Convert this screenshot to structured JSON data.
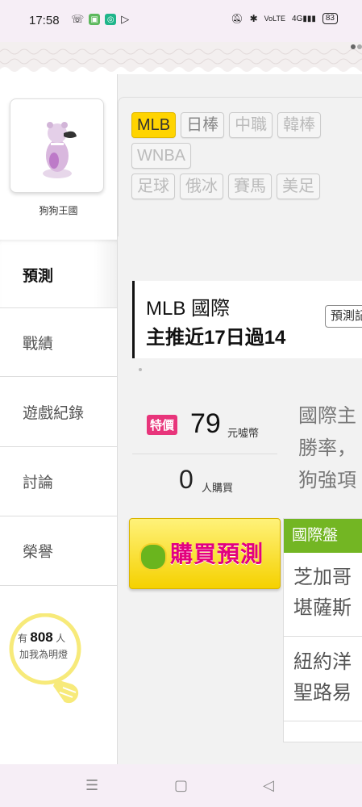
{
  "status_bar": {
    "time": "17:58",
    "battery": "83",
    "network": "4G"
  },
  "profile": {
    "name": "狗狗王國"
  },
  "leagues": [
    {
      "label": "MLB",
      "state": "active"
    },
    {
      "label": "日棒",
      "state": "normal"
    },
    {
      "label": "中職",
      "state": "dim"
    },
    {
      "label": "韓棒",
      "state": "dim"
    },
    {
      "label": "WNBA",
      "state": "dim"
    },
    {
      "label": "足球",
      "state": "dim"
    },
    {
      "label": "俄冰",
      "state": "dim"
    },
    {
      "label": "賽馬",
      "state": "dim"
    },
    {
      "label": "美足",
      "state": "dim"
    }
  ],
  "sidebar": {
    "tabs": [
      {
        "label": "預測"
      },
      {
        "label": "戰績"
      },
      {
        "label": "遊戲紀錄"
      },
      {
        "label": "討論"
      },
      {
        "label": "榮譽"
      }
    ],
    "fans": {
      "prefix": "有",
      "count": "808",
      "suffix": "人",
      "line2": "加我為明燈"
    }
  },
  "prediction": {
    "title": "MLB 國際",
    "subtitle": "主推近17日過14",
    "button_label": "預測記"
  },
  "offer": {
    "badge": "特價",
    "price": "79",
    "currency": "元噓幣",
    "buyers": "0",
    "buyers_unit": "人購買",
    "desc_lines": [
      "國際主",
      "勝率，",
      "狗強項"
    ]
  },
  "buy_button": {
    "label": "購買預測"
  },
  "intl_panel": {
    "header": "國際盤",
    "games": [
      {
        "line1": "芝加哥",
        "line2": "堪薩斯"
      },
      {
        "line1": "紐約洋",
        "line2": "聖路易"
      }
    ]
  },
  "colors": {
    "accent_yellow": "#ffd400",
    "pink": "#e8357b",
    "green": "#73b623"
  }
}
